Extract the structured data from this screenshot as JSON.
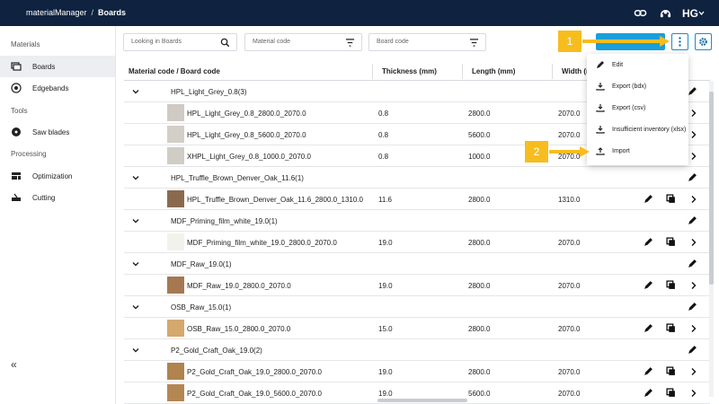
{
  "topbar": {
    "app_name": "materialManager",
    "separator": "/",
    "page": "Boards",
    "icons": [
      "link-icon",
      "support-icon",
      "brand-logo-icon"
    ]
  },
  "sidebar": {
    "sections": [
      {
        "label": "Materials"
      },
      {
        "label": "Tools"
      },
      {
        "label": "Processing"
      }
    ],
    "items": [
      {
        "label": "Boards",
        "icon": "boards-icon",
        "active": true
      },
      {
        "label": "Edgebands",
        "icon": "edgebands-icon"
      },
      {
        "label": "Saw blades",
        "icon": "saw-blade-icon"
      },
      {
        "label": "Optimization",
        "icon": "optimization-icon"
      },
      {
        "label": "Cutting",
        "icon": "cutting-icon"
      }
    ],
    "collapse_label": "«"
  },
  "toolbar": {
    "search_placeholder": "Looking in Boards",
    "filter1_placeholder": "Material code",
    "filter2_placeholder": "Board code"
  },
  "table": {
    "headers": {
      "code": "Material code / Board code",
      "thickness": "Thickness (mm)",
      "length": "Length (mm)",
      "width": "Width (m"
    },
    "groups": [
      {
        "name": "HPL_Light_Grey_0.8(3)",
        "items": [
          {
            "code": "HPL_Light_Grey_0.8_2800.0_2070.0",
            "thickness": "0.8",
            "length": "2800.0",
            "width": "2070.0",
            "color": "#cfcac4"
          },
          {
            "code": "HPL_Light_Grey_0.8_5600.0_2070.0",
            "thickness": "0.8",
            "length": "5600.0",
            "width": "2070.0",
            "color": "#d3cec8"
          },
          {
            "code": "XHPL_Light_Grey_0.8_1000.0_2070.0",
            "thickness": "0.8",
            "length": "1000.0",
            "width": "2070.0",
            "color": "#d1ccc6"
          }
        ]
      },
      {
        "name": "HPL_Truffle_Brown_Denver_Oak_11.6(1)",
        "items": [
          {
            "code": "HPL_Truffle_Brown_Denver_Oak_11.6_2800.0_1310.0",
            "thickness": "11.6",
            "length": "2800.0",
            "width": "1310.0",
            "color": "#8a6a4e"
          }
        ]
      },
      {
        "name": "MDF_Priming_film_white_19.0(1)",
        "items": [
          {
            "code": "MDF_Priming_film_white_19.0_2800.0_2070.0",
            "thickness": "19.0",
            "length": "2800.0",
            "width": "2070.0",
            "color": "#f3f1ec"
          }
        ]
      },
      {
        "name": "MDF_Raw_19.0(1)",
        "items": [
          {
            "code": "MDF_Raw_19.0_2800.0_2070.0",
            "thickness": "19.0",
            "length": "2800.0",
            "width": "2070.0",
            "color": "#a67852"
          }
        ]
      },
      {
        "name": "OSB_Raw_15.0(1)",
        "items": [
          {
            "code": "OSB_Raw_15.0_2800.0_2070.0",
            "thickness": "15.0",
            "length": "2800.0",
            "width": "2070.0",
            "color": "#d4a86e"
          }
        ]
      },
      {
        "name": "P2_Gold_Craft_Oak_19.0(2)",
        "items": [
          {
            "code": "P2_Gold_Craft_Oak_19.0_2800.0_2070.0",
            "thickness": "19.0",
            "length": "2800.0",
            "width": "2070.0",
            "color": "#b0834f"
          },
          {
            "code": "P2_Gold_Craft_Oak_19.0_5600.0_2070.0",
            "thickness": "19.0",
            "length": "5600.0",
            "width": "2070.0",
            "color": "#b48752"
          }
        ]
      }
    ]
  },
  "menu": {
    "items": [
      {
        "label": "Edit",
        "icon": "pencil-icon"
      },
      {
        "label": "Export (bdx)",
        "icon": "download-icon"
      },
      {
        "label": "Export (csv)",
        "icon": "download-icon"
      },
      {
        "label": "Insufficient inventory (xlsx)",
        "icon": "download-icon"
      },
      {
        "label": "Import",
        "icon": "upload-icon"
      }
    ]
  },
  "callouts": {
    "one": "1",
    "two": "2"
  },
  "colors": {
    "topbar": "#0f2340",
    "accent": "#1a9fd8",
    "callout": "#f7bd1e"
  }
}
